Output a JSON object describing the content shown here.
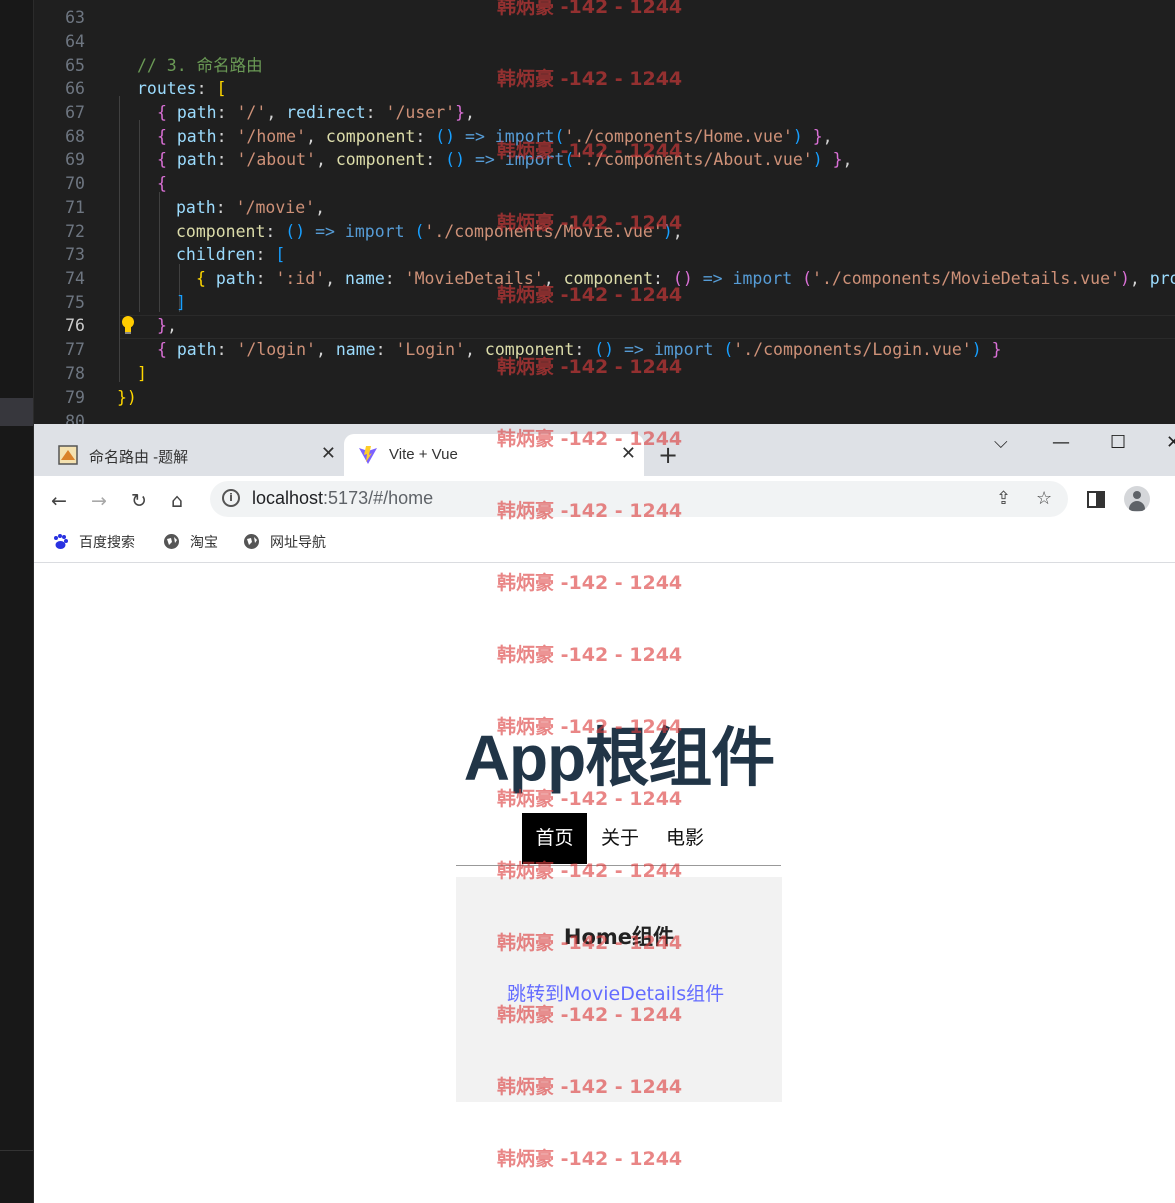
{
  "editor": {
    "line_numbers": [
      "63",
      "64",
      "65",
      "66",
      "67",
      "68",
      "69",
      "70",
      "71",
      "72",
      "73",
      "74",
      "75",
      "76",
      "77",
      "78",
      "79",
      "80"
    ],
    "current_line": "76",
    "comment": "// 3. 命名路由",
    "code": {
      "routes_key": "routes",
      "r1_path": "'/'",
      "r1_redirect_key": "redirect",
      "r1_redirect": "'/user'",
      "r2_path": "'/home'",
      "r2_import": "'./components/Home.vue'",
      "r3_path": "'/about'",
      "r3_import": "'./components/About.vue'",
      "r4_path": "'/movie'",
      "r4_import": "'./components/Movie.vue'",
      "children_key": "children",
      "c1_path": "':id'",
      "c1_name": "'MovieDetails'",
      "c1_import": "'./components/MovieDetails.vue'",
      "c1_tail": "props:",
      "r5_path": "'/login'",
      "r5_name": "'Login'",
      "r5_import": "'./components/Login.vue'",
      "kw_path": "path",
      "kw_component": "component",
      "kw_name": "name",
      "kw_import": "import"
    }
  },
  "browser": {
    "tabs": [
      {
        "title": "命名路由 -题解",
        "active": false
      },
      {
        "title": "Vite + Vue",
        "active": true
      }
    ],
    "url_host": "localhost",
    "url_rest": ":5173/#/home",
    "bookmarks": [
      "百度搜索",
      "淘宝",
      "网址导航"
    ],
    "page": {
      "title": "App根组件",
      "nav": [
        "首页",
        "关于",
        "电影"
      ],
      "active_nav": "首页",
      "home_heading": "Home组件",
      "home_link": "跳转到MovieDetails组件"
    }
  },
  "watermark": "韩炳豪 -142 - 1244",
  "colors": {
    "editor_bg": "#1f1f1f",
    "comment": "#6a9955",
    "string": "#ce9178",
    "keyword": "#569cd6",
    "property": "#9cdcfe",
    "link": "#646cff",
    "title": "#213547",
    "watermark": "#dc3c3c"
  },
  "icons": [
    "back-icon",
    "forward-icon",
    "reload-icon",
    "home-icon",
    "info-icon",
    "share-icon",
    "star-icon",
    "sidepanel-icon",
    "profile-icon",
    "baidu-icon",
    "globe-icon",
    "chevron-down-icon",
    "minimize-icon",
    "maximize-icon",
    "close-icon",
    "lightbulb-icon"
  ]
}
